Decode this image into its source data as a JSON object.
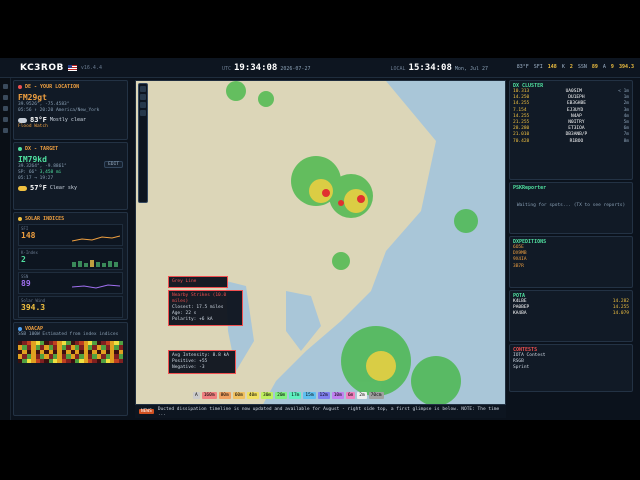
{
  "header": {
    "callsign": "KC3ROB",
    "version": "v16.4.4",
    "utc_label": "UTC",
    "utc_time": "19:34:08",
    "utc_date": "2026-07-27",
    "local_label": "LOCAL",
    "local_time": "15:34:08",
    "local_date": "Mon, Jul 27",
    "stats": [
      {
        "k": "83°F",
        "v": ""
      },
      {
        "k": "SFI",
        "v": "148"
      },
      {
        "k": "K",
        "v": "2"
      },
      {
        "k": "SSN",
        "v": "89"
      },
      {
        "k": "A",
        "v": "9"
      },
      {
        "k": "",
        "v": "394.3"
      }
    ]
  },
  "de": {
    "title": "DE - YOUR LOCATION",
    "grid": "FM29gt",
    "coords": "39.9526°, -75.4583°",
    "tz": "America/New_York",
    "sun": "05:56 ↑ 20:20",
    "temp": "83°F",
    "cond": "Mostly clear",
    "alert": "Flood Watch"
  },
  "dx": {
    "title": "DX - TARGET",
    "grid": "IM79kd",
    "coords": "39.3264°, -9.8861°",
    "bearing": "SP: 66°",
    "dist": "3,458 mi",
    "sun": "05:17 → 19:27",
    "temp": "57°F",
    "cond": "Clear sky",
    "btn": "EDIT"
  },
  "solar": {
    "title": "SOLAR INDICES",
    "sfi_label": "SFI",
    "sfi": "148",
    "k_label": "K-Index",
    "k": "2",
    "ssn_label": "SSN",
    "ssn": "89",
    "wind_label": "Solar Wind",
    "wind": "394.3"
  },
  "voacap": {
    "title": "VOACAP",
    "mode": "SSB",
    "power": "100W",
    "note": "Estimated from index indices"
  },
  "dxcluster": {
    "title": "DX CLUSTER",
    "spots": [
      {
        "f": "10.313",
        "c": "UA0SIM",
        "a": "< 1m"
      },
      {
        "f": "14.250",
        "c": "DU1EPH",
        "a": "1m"
      },
      {
        "f": "14.255",
        "c": "EB3GHBE",
        "a": "2m"
      },
      {
        "f": "7.154",
        "c": "EJ3UYD",
        "a": "3m"
      },
      {
        "f": "14.255",
        "c": "N4AP",
        "a": "4m"
      },
      {
        "f": "21.255",
        "c": "N0ITRY",
        "a": "5m"
      },
      {
        "f": "28.280",
        "c": "ET3IOA",
        "a": "6m"
      },
      {
        "f": "21.010",
        "c": "DB3ANB/P",
        "a": "7m"
      },
      {
        "f": "70.428",
        "c": "R1BOO",
        "a": "8m"
      }
    ]
  },
  "psk": {
    "title": "PSKReporter",
    "msg": "Waiting for spots... (TX to see reports)"
  },
  "expeditions": {
    "title": "DXPEDITIONS",
    "items": [
      "6O5E",
      "DX9MB",
      "9X4IA",
      "3B7R"
    ]
  },
  "pota": {
    "title": "POTA",
    "items": [
      {
        "c": "K4LBE",
        "f": "14.282"
      },
      {
        "c": "PA0BEP",
        "f": "14.255"
      },
      {
        "c": "KA4BA",
        "f": "14.079"
      }
    ]
  },
  "contests": {
    "title": "CONTESTS",
    "items": [
      "IOTA Contest",
      "RSGB",
      "Sprint"
    ]
  },
  "map": {
    "view": "Hybrid",
    "layer": "Nat Geo",
    "popup1": {
      "title": "Grey Line"
    },
    "popup2": {
      "title": "Nearby Strikes (10.0 miles)",
      "l1": "Closest: 17.5 miles",
      "l2": "Age: 22 s",
      "l3": "Polarity: +6 kA"
    },
    "popup3": {
      "l1": "Avg Intensity:",
      "v1": "8.8 kA",
      "l2": "Positive:",
      "v2": "+55",
      "l3": "Negative:",
      "v3": "-3"
    }
  },
  "ticker": {
    "tag": "NEWS",
    "text": "Ducted dissipation timeline is now updated and available for August - right side top, a first glimpse is below. NOTE: The time ..."
  },
  "legend": [
    "A",
    "160m",
    "80m",
    "60m",
    "40m",
    "30m",
    "20m",
    "17m",
    "15m",
    "12m",
    "10m",
    "6m",
    "2m",
    "70cm"
  ]
}
